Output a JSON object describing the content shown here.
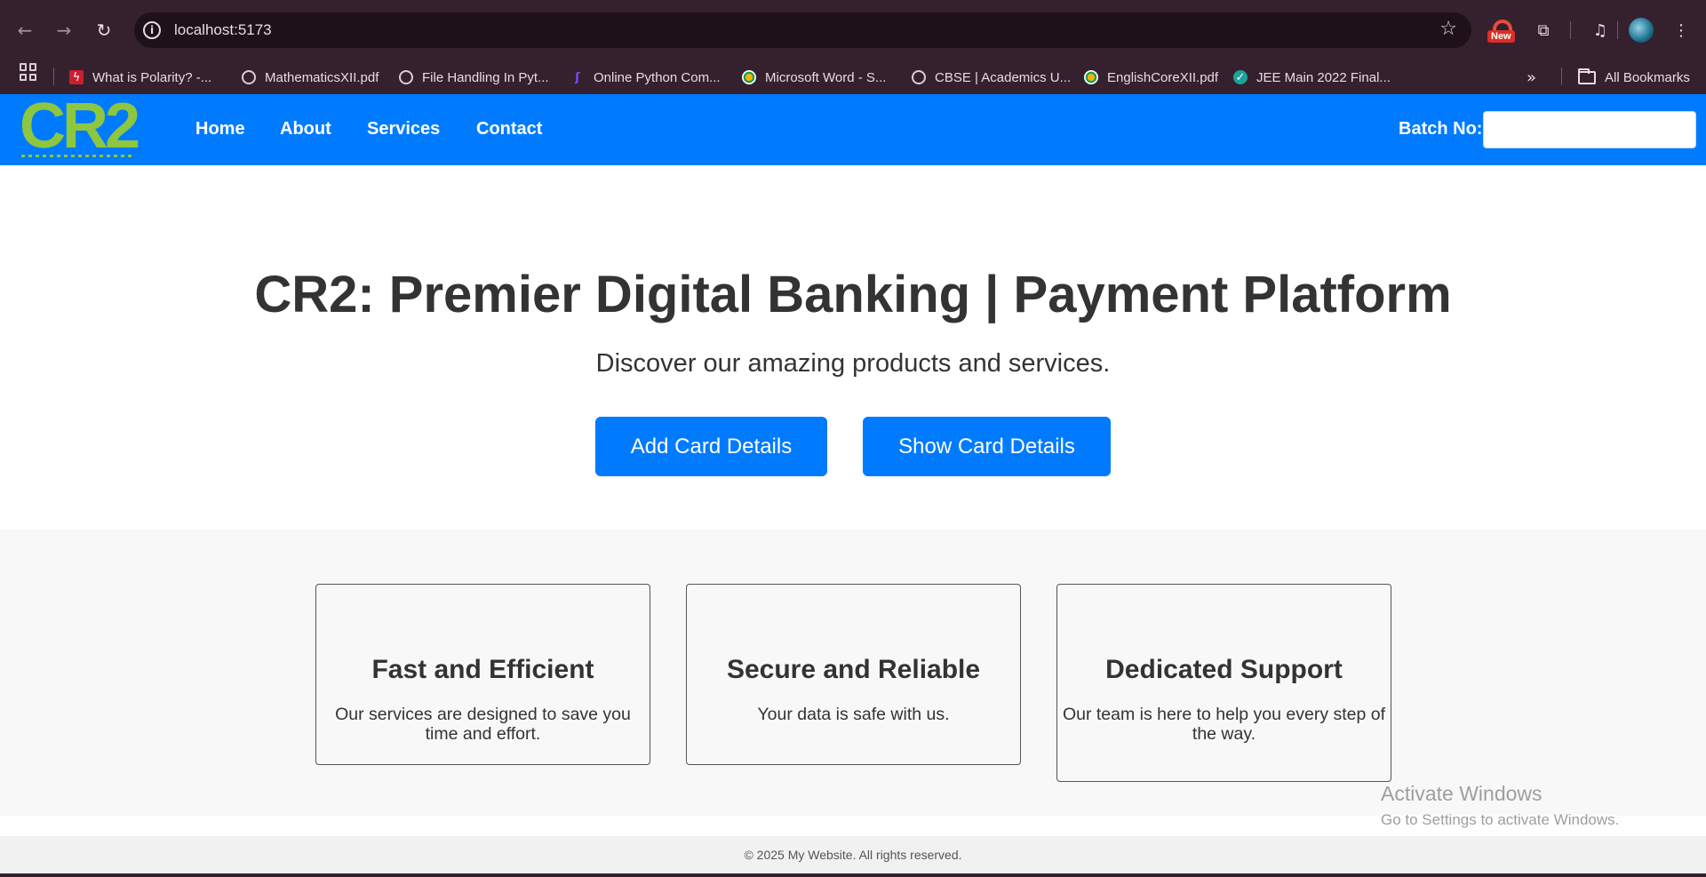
{
  "browser": {
    "url": "localhost:5173",
    "bookmarks": [
      {
        "label": "What is Polarity? -...",
        "icon": "bolt-favicon"
      },
      {
        "label": "MathematicsXII.pdf",
        "icon": "globe-icon"
      },
      {
        "label": "File Handling In Pyt...",
        "icon": "globe-icon"
      },
      {
        "label": "Online Python Com...",
        "icon": "colab-favicon"
      },
      {
        "label": "Microsoft Word - S...",
        "icon": "dot-favicon"
      },
      {
        "label": "CBSE | Academics U...",
        "icon": "globe-icon"
      },
      {
        "label": "EnglishCoreXII.pdf",
        "icon": "dot-favicon"
      },
      {
        "label": "JEE Main 2022 Final...",
        "icon": "jee-favicon"
      }
    ],
    "all_bookmarks_label": "All Bookmarks",
    "new_badge": "New",
    "more_chevron": "»"
  },
  "header": {
    "logo_text": "CR2",
    "nav": [
      "Home",
      "About",
      "Services",
      "Contact"
    ],
    "batch_label": "Batch No:",
    "batch_value": ""
  },
  "hero": {
    "title": "CR2: Premier Digital Banking | Payment Platform",
    "subtitle": "Discover our amazing products and services.",
    "add_button": "Add Card Details",
    "show_button": "Show Card Details"
  },
  "features": [
    {
      "title": "Fast and Efficient",
      "text": "Our services are designed to save you time and effort."
    },
    {
      "title": "Secure and Reliable",
      "text": "Your data is safe with us."
    },
    {
      "title": "Dedicated Support",
      "text": "Our team is here to help you every step of the way."
    }
  ],
  "watermark": {
    "line1": "Activate Windows",
    "line2": "Go to Settings to activate Windows."
  },
  "footer": {
    "text": "© 2025 My Website. All rights reserved."
  },
  "colors": {
    "primary": "#007bff",
    "logo_green": "#8dc63f",
    "browser_chrome": "#35202e"
  }
}
